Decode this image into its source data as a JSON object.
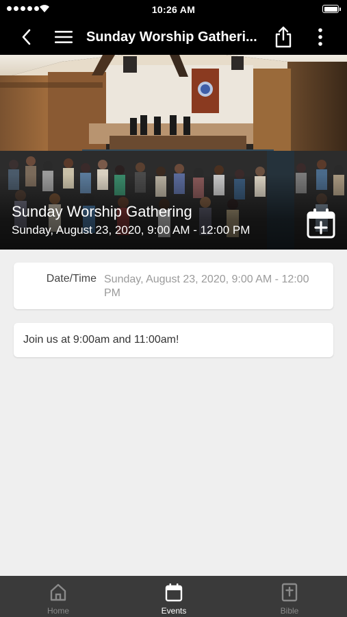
{
  "status_bar": {
    "time": "10:26 AM"
  },
  "nav": {
    "title": "Sunday Worship Gatheri...",
    "icons": [
      "chevron-left-icon",
      "hamburger-menu-icon",
      "share-icon",
      "more-vertical-icon"
    ]
  },
  "hero": {
    "event_title": "Sunday Worship Gathering",
    "event_datetime": "Sunday, August 23, 2020, 9:00 AM - 12:00 PM",
    "add_to_calendar_icon": "calendar-plus-icon"
  },
  "details": {
    "datetime_label": "Date/Time",
    "datetime_value": "Sunday, August 23, 2020, 9:00 AM - 12:00 PM",
    "description": "Join us at 9:00am and 11:00am!"
  },
  "tabs": [
    {
      "label": "Home",
      "icon": "home-icon",
      "active": false
    },
    {
      "label": "Events",
      "icon": "calendar-icon",
      "active": true
    },
    {
      "label": "Bible",
      "icon": "bible-icon",
      "active": false
    }
  ],
  "colors": {
    "bar_background": "#000000",
    "tab_bar_background": "#3a3a3a",
    "page_background": "#efefef",
    "tab_active": "#ffffff",
    "tab_inactive": "#8a8a8a"
  }
}
